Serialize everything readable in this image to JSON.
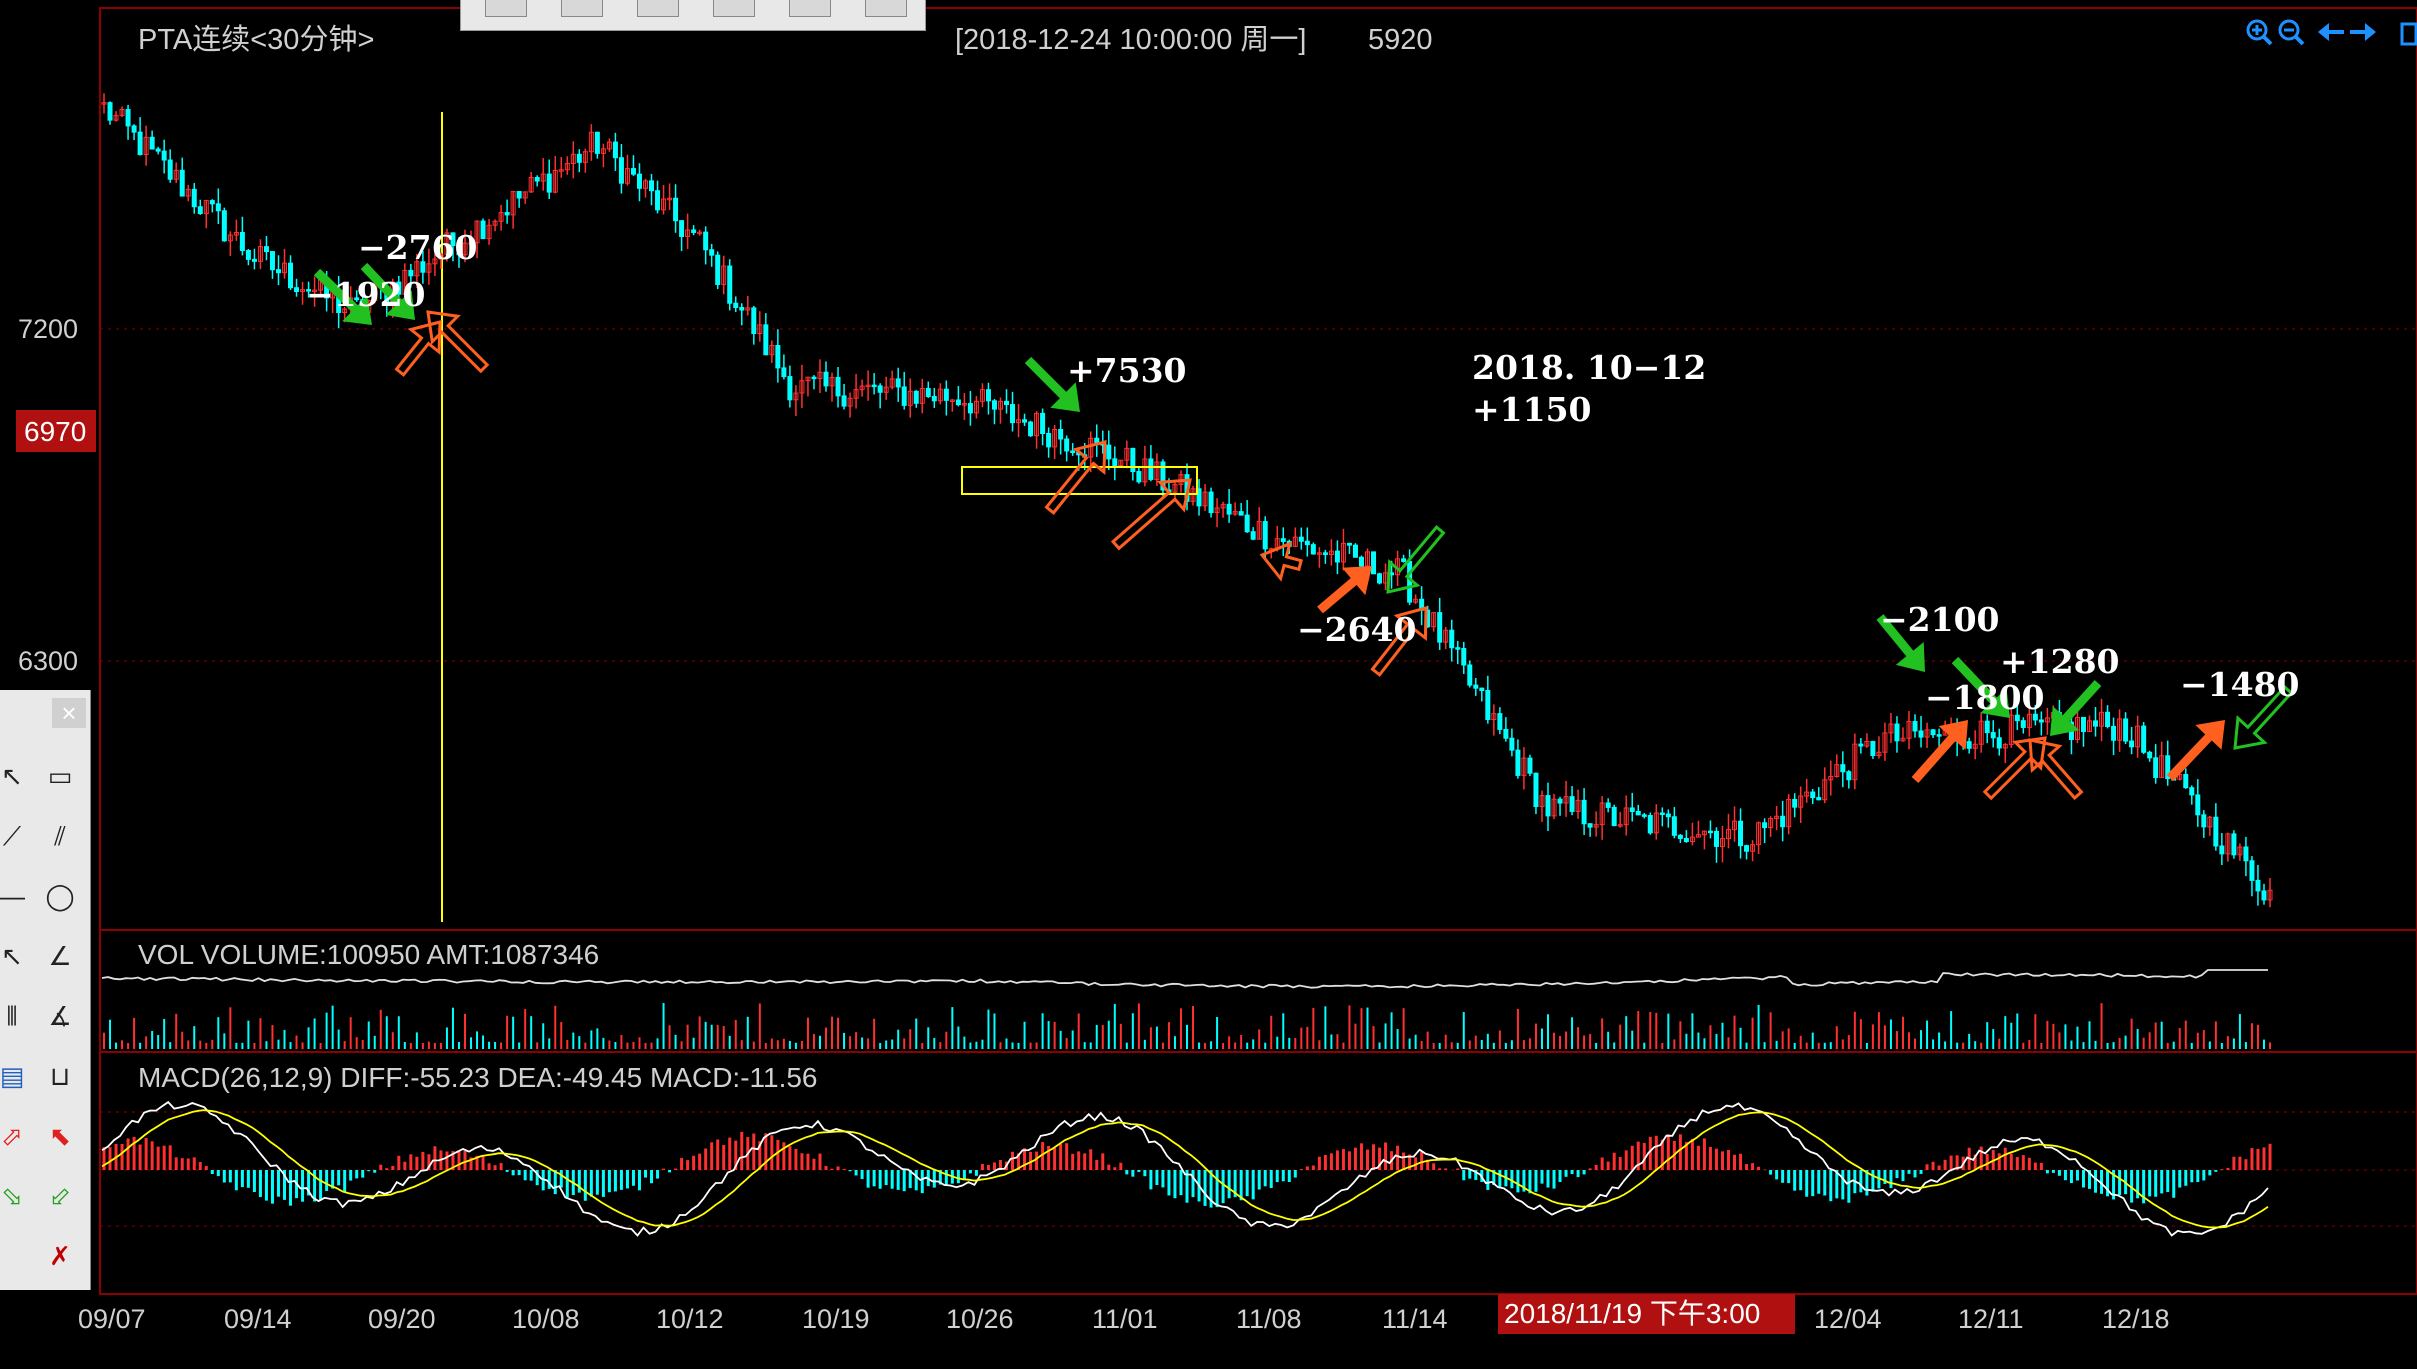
{
  "window": {
    "title": "PTA连续<30分钟>",
    "datetime": "[2018-12-24  10:00:00 周一]",
    "price_readout": "5920"
  },
  "price_axis": {
    "labels": [
      "7200",
      "6300"
    ],
    "current_price_tag": "6970"
  },
  "volume_panel": {
    "label": "VOL  VOLUME:100950 AMT:1087346"
  },
  "macd_panel": {
    "label": "MACD(26,12,9)  DIFF:-55.23 DEA:-49.45 MACD:-11.56"
  },
  "date_axis": {
    "labels": [
      "09/07",
      "09/14",
      "09/20",
      "10/08",
      "10/12",
      "10/19",
      "10/26",
      "11/01",
      "11/08",
      "11/14",
      "12/04",
      "12/11",
      "12/18"
    ],
    "cursor_time": "2018/11/19 下午3:00"
  },
  "annotations": [
    {
      "text": "−2760",
      "color": "#ffffff"
    },
    {
      "text": "−1920",
      "color": "#ffffff"
    },
    {
      "text": "+7530",
      "color": "#ffffff"
    },
    {
      "text": "2018. 10−12",
      "color": "#ffffff"
    },
    {
      "text": "+1150",
      "color": "#ffffff"
    },
    {
      "text": "−2640",
      "color": "#ffffff"
    },
    {
      "text": "−2100",
      "color": "#ffffff"
    },
    {
      "text": "−1800",
      "color": "#ffffff"
    },
    {
      "text": "+1280",
      "color": "#ffffff"
    },
    {
      "text": "−1480",
      "color": "#ffffff"
    }
  ],
  "icons": {
    "zoom_in": "zoom-in-icon",
    "zoom_out": "zoom-out-icon",
    "scroll_left": "arrow-left-icon",
    "scroll_right": "arrow-right-icon"
  },
  "colors": {
    "up": "#ff3030",
    "down": "#00ffff",
    "diff_line": "#ffffff",
    "dea_line": "#ffff00",
    "grid": "#8b0000",
    "buy_arrow": "#ff6020",
    "sell_arrow": "#22c020"
  },
  "chart_data": [
    {
      "type": "candlestick",
      "title": "PTA连续<30分钟>",
      "x": [
        "09/07",
        "09/14",
        "09/20",
        "10/08",
        "10/12",
        "10/19",
        "10/26",
        "11/01",
        "11/08",
        "11/14",
        "11/19",
        "12/04",
        "12/11",
        "12/18",
        "12/24"
      ],
      "close_path": [
        7600,
        7280,
        7160,
        7520,
        7300,
        7000,
        6980,
        6850,
        6680,
        6600,
        6100,
        6040,
        6250,
        6280,
        5920
      ],
      "ylim": [
        5850,
        7800
      ],
      "ytick_labels": [
        "7200",
        "6300"
      ]
    },
    {
      "type": "bar",
      "title": "VOL  VOLUME:100950 AMT:1087346",
      "series": [
        {
          "name": "VOLUME",
          "last": 100950
        }
      ]
    },
    {
      "type": "line",
      "title": "MACD(26,12,9)",
      "series": [
        {
          "name": "DIFF",
          "last": -55.23
        },
        {
          "name": "DEA",
          "last": -49.45
        },
        {
          "name": "MACD",
          "last": -11.56
        }
      ]
    }
  ]
}
